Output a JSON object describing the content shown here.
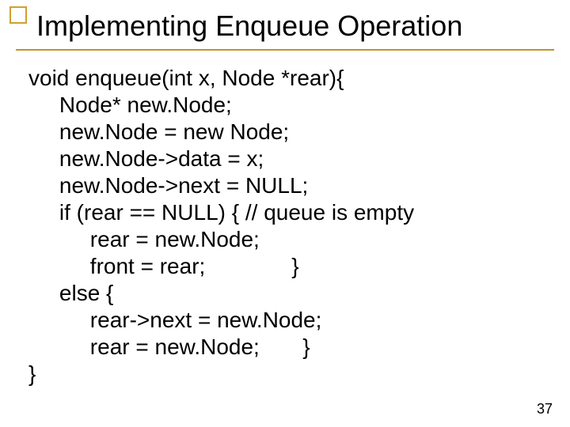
{
  "slide": {
    "title": "Implementing Enqueue Operation",
    "code": "void enqueue(int x, Node *rear){\n     Node* new.Node;\n     new.Node = new Node;\n     new.Node->data = x;\n     new.Node->next = NULL;\n     if (rear == NULL) { // queue is empty\n          rear = new.Node;\n          front = rear;              }\n     else {\n          rear->next = new.Node;\n          rear = new.Node;       }\n}",
    "page_number": "37"
  }
}
